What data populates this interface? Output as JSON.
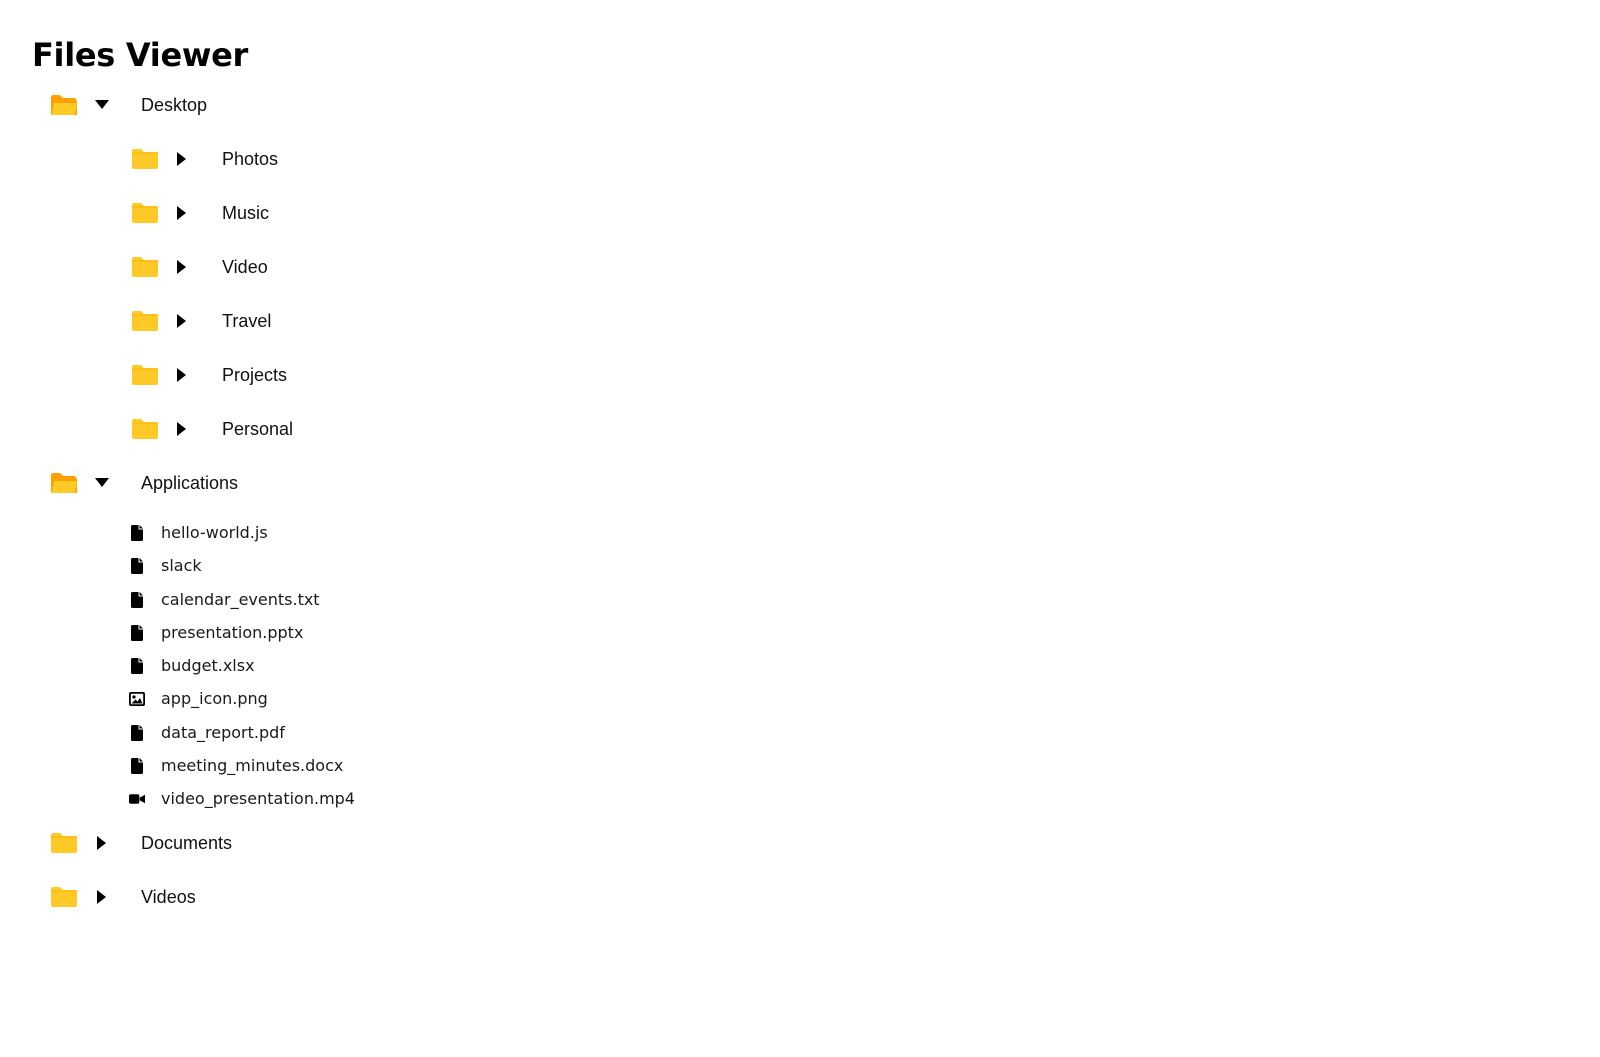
{
  "app": {
    "title": "Files Viewer"
  },
  "colors": {
    "folder": "#FFCA28",
    "folder_dark": "#FFA000",
    "text": "#111111"
  },
  "tree": {
    "desktop": {
      "label": "Desktop",
      "expanded": true,
      "children": [
        {
          "label": "Photos",
          "expanded": false
        },
        {
          "label": "Music",
          "expanded": false
        },
        {
          "label": "Video",
          "expanded": false
        },
        {
          "label": "Travel",
          "expanded": false
        },
        {
          "label": "Projects",
          "expanded": false
        },
        {
          "label": "Personal",
          "expanded": false
        }
      ]
    },
    "applications": {
      "label": "Applications",
      "expanded": true,
      "files": [
        {
          "label": "hello-world.js",
          "icon": "file-icon"
        },
        {
          "label": "slack",
          "icon": "file-icon"
        },
        {
          "label": "calendar_events.txt",
          "icon": "file-icon"
        },
        {
          "label": "presentation.pptx",
          "icon": "file-icon"
        },
        {
          "label": "budget.xlsx",
          "icon": "file-icon"
        },
        {
          "label": "app_icon.png",
          "icon": "image-icon"
        },
        {
          "label": "data_report.pdf",
          "icon": "file-icon"
        },
        {
          "label": "meeting_minutes.docx",
          "icon": "file-icon"
        },
        {
          "label": "video_presentation.mp4",
          "icon": "video-camera-icon"
        }
      ]
    },
    "documents": {
      "label": "Documents",
      "expanded": false
    },
    "videos": {
      "label": "Videos",
      "expanded": false
    }
  }
}
